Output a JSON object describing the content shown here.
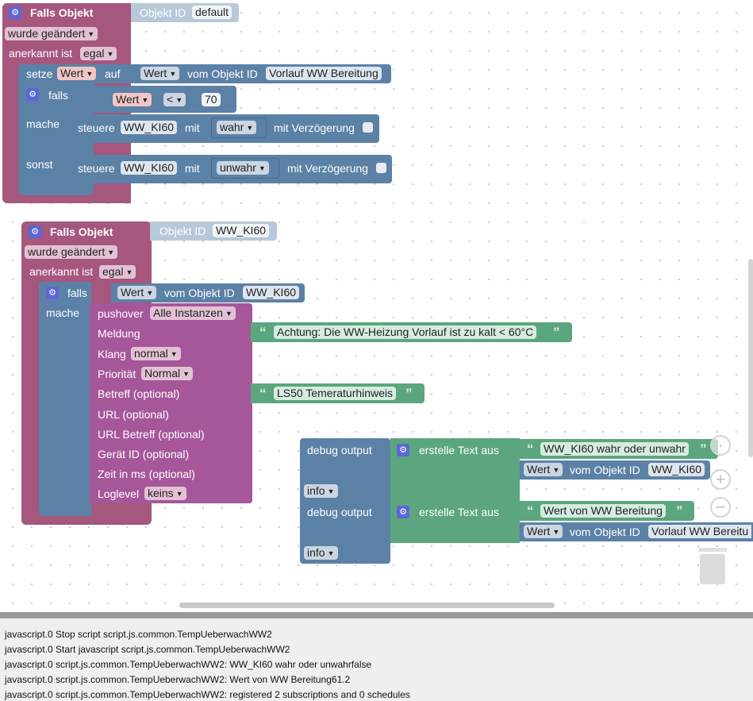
{
  "colors": {
    "event_block": "#a5577e",
    "logic_block": "#5c81a6",
    "text_block": "#5ba67e",
    "notify_block": "#a5579a",
    "objectid_block": "#b7c8d9"
  },
  "script1": {
    "header": "Falls Objekt",
    "objid_label": "Objekt ID",
    "objid_value": "default",
    "trigger": "wurde geändert",
    "ack_label": "anerkannt ist",
    "ack_value": "egal",
    "set_label": "setze",
    "set_var": "Wert",
    "set_on": "auf",
    "get_prop": "Wert",
    "get_from": "vom Objekt ID",
    "get_obj": "Vorlauf WW Bereitung",
    "if_label": "falls",
    "cond_var": "Wert",
    "cond_op": "<",
    "cond_num": "70",
    "do_label": "mache",
    "else_label": "sonst",
    "ctrl1_label": "steuere",
    "ctrl1_obj": "WW_KI60",
    "ctrl1_with": "mit",
    "ctrl1_value": "wahr",
    "ctrl1_delay": "mit Verzögerung",
    "ctrl2_label": "steuere",
    "ctrl2_obj": "WW_KI60",
    "ctrl2_with": "mit",
    "ctrl2_value": "unwahr",
    "ctrl2_delay": "mit Verzögerung"
  },
  "script2": {
    "header": "Falls Objekt",
    "objid_label": "Objekt ID",
    "objid_value": "WW_KI60",
    "trigger": "wurde geändert",
    "ack_label": "anerkannt ist",
    "ack_value": "egal",
    "if_label": "falls",
    "cond_prop": "Wert",
    "cond_from": "vom Objekt ID",
    "cond_obj": "WW_KI60",
    "do_label": "mache",
    "pushover": {
      "label": "pushover",
      "instances": "Alle Instanzen",
      "message_label": "Meldung",
      "message_text": "Achtung: Die WW-Heizung Vorlauf ist zu kalt < 60°C",
      "sound_label": "Klang",
      "sound_value": "normal",
      "priority_label": "Priorität",
      "priority_value": "Normal",
      "subject_label": "Betreff (optional)",
      "subject_text": "LS50 Temeraturhinweis",
      "url_label": "URL (optional)",
      "url_subject_label": "URL Betreff (optional)",
      "device_label": "Gerät ID (optional)",
      "time_label": "Zeit in ms (optional)",
      "loglevel_label": "Loglevel",
      "loglevel_value": "keins"
    }
  },
  "debug1": {
    "label": "debug output",
    "level": "info",
    "create_text": "erstelle Text aus",
    "text": "WW_KI60 wahr oder unwahr",
    "prop": "Wert",
    "from": "vom Objekt ID",
    "obj": "WW_KI60"
  },
  "debug2": {
    "label": "debug output",
    "level": "info",
    "create_text": "erstelle Text aus",
    "text": "Wert von WW Bereitung",
    "prop": "Wert",
    "from": "vom Objekt ID",
    "obj": "Vorlauf WW Bereitu"
  },
  "workspace_controls": {
    "zoom_in": "+",
    "zoom_out": "−"
  },
  "log": [
    "javascript.0 Stop script script.js.common.TempUeberwachWW2",
    "javascript.0 Start javascript script.js.common.TempUeberwachWW2",
    "javascript.0 script.js.common.TempUeberwachWW2: WW_KI60 wahr oder unwahrfalse",
    "javascript.0 script.js.common.TempUeberwachWW2: Wert von WW Bereitung61.2",
    "javascript.0 script.js.common.TempUeberwachWW2: registered 2 subscriptions and 0 schedules"
  ]
}
